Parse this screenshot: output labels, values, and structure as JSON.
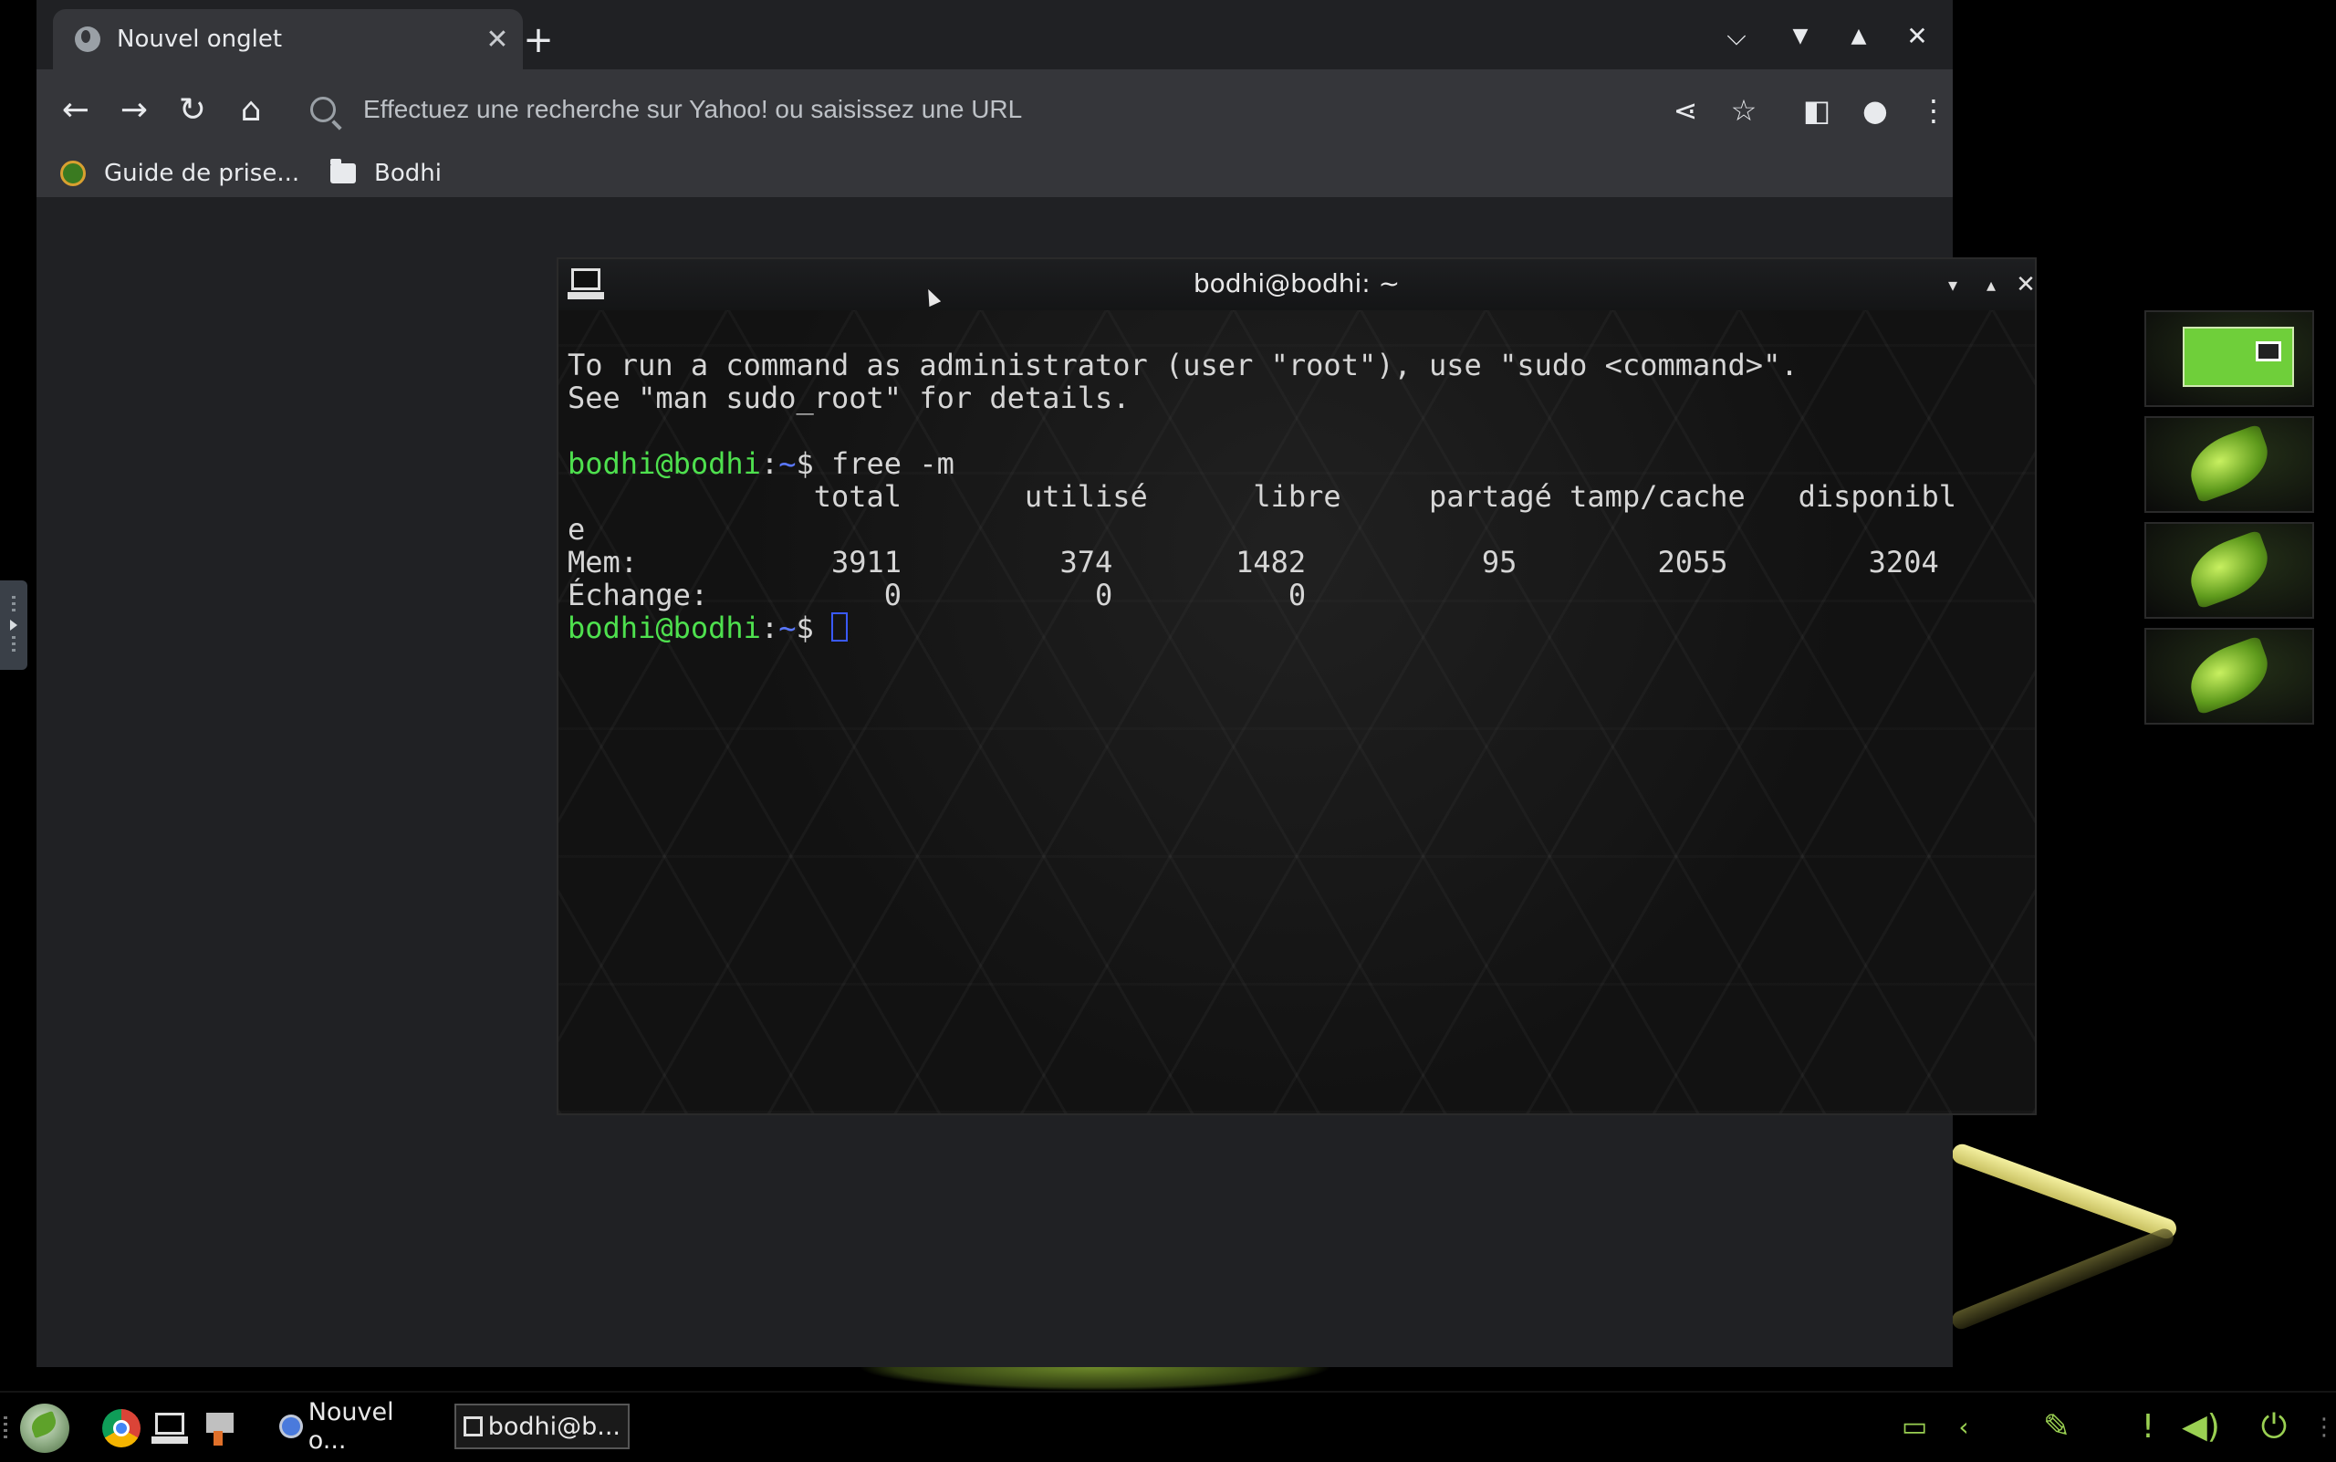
{
  "browser": {
    "tab_title": "Nouvel onglet",
    "tab_close": "✕",
    "new_tab": "+",
    "address_placeholder": "Effectuez une recherche sur Yahoo! ou saisissez une URL",
    "bookmarks": [
      "Guide de prise...",
      "Bodhi"
    ]
  },
  "terminal": {
    "title": "bodhi@bodhi: ~",
    "user_host": "bodhi@bodhi",
    "path": "~",
    "lines": {
      "l1": "To run a command as administrator (user \"root\"), use \"sudo <command>\".",
      "l2": "See \"man sudo_root\" for details.",
      "cmd": "free -m",
      "header": "              total       utilisé      libre     partagé tamp/cache   disponibl",
      "wrap": "e",
      "mem": "Mem:           3911         374       1482          95        2055        3204",
      "swap": "Échange:          0           0          0"
    }
  },
  "taskbar": {
    "tasks": [
      "Nouvel o...",
      "bodhi@b..."
    ]
  },
  "colors": {
    "prompt_user": "#4ee04e",
    "prompt_path": "#5a78ff",
    "accent_tray": "#9ad052"
  }
}
